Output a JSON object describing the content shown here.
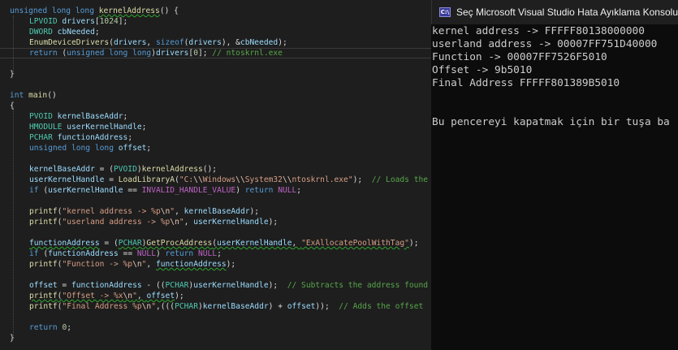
{
  "editor": {
    "code_lines": [
      [
        "unsigned long long ",
        "kernelAddress",
        "() {"
      ],
      [
        "LPVOID",
        " drivers",
        "[",
        "1024",
        "];"
      ],
      [
        "DWORD",
        " cbNeeded",
        ";"
      ],
      [
        "EnumDeviceDrivers",
        "(",
        "drivers",
        ", ",
        "sizeof",
        "(",
        "drivers",
        "), &",
        "cbNeeded",
        ");"
      ],
      [
        "return",
        " (",
        "unsigned long long",
        ")",
        "drivers",
        "[",
        "0",
        "]; ",
        "// ntoskrnl.exe"
      ],
      [
        "}"
      ],
      [
        "int",
        " main",
        "()"
      ],
      [
        "{"
      ],
      [
        "PVOID",
        " kernelBaseAddr",
        ";"
      ],
      [
        "HMODULE",
        " userKernelHandle",
        ";"
      ],
      [
        "PCHAR",
        " functionAddress",
        ";"
      ],
      [
        "unsigned long long",
        " offset",
        ";"
      ],
      [
        "kernelBaseAddr",
        " = (",
        "PVOID",
        ")",
        "kernelAddress",
        "();"
      ],
      [
        "userKernelHandle",
        " = ",
        "LoadLibraryA",
        "(",
        "\"C:",
        "\\\\",
        "Windows",
        "\\\\",
        "System32",
        "\\\\",
        "ntoskrnl.exe\"",
        ");  ",
        "// Loads the"
      ],
      [
        "if",
        " (",
        "userKernelHandle",
        " == ",
        "INVALID_HANDLE_VALUE",
        ") ",
        "return",
        " ",
        "NULL",
        ";"
      ],
      [
        "printf",
        "(",
        "\"kernel address -> %p",
        "\\n",
        "\"",
        ", ",
        "kernelBaseAddr",
        ");"
      ],
      [
        "printf",
        "(",
        "\"userland address -> %p",
        "\\n",
        "\"",
        ", ",
        "userKernelHandle",
        ");"
      ],
      [
        "functionAddress",
        " = (",
        "PCHAR",
        ")",
        "GetProcAddress",
        "(",
        "userKernelHandle",
        ", ",
        "\"ExAllocatePoolWithTag\"",
        ");"
      ],
      [
        "if",
        " (",
        "functionAddress",
        " == ",
        "NULL",
        ") ",
        "return",
        " ",
        "NULL",
        ";"
      ],
      [
        "printf",
        "(",
        "\"Function -> %p",
        "\\n",
        "\"",
        ", ",
        "functionAddress",
        ");"
      ],
      [
        "offset",
        " = ",
        "functionAddress",
        " - ((",
        "PCHAR",
        ")",
        "userKernelHandle",
        ");  ",
        "// Subtracts the address found"
      ],
      [
        "printf",
        "(",
        "\"Offset -> %x",
        "\\n",
        "\"",
        ", ",
        "offset",
        ");"
      ],
      [
        "printf",
        "(",
        "\"Final Address %p",
        "\\n",
        "\"",
        ",(((",
        "PCHAR",
        ")",
        "kernelBaseAddr",
        ") + ",
        "offset",
        "));  ",
        "// Adds the offset"
      ],
      [
        "return",
        " ",
        "0",
        ";"
      ],
      [
        "}"
      ]
    ]
  },
  "console": {
    "title": "Seç Microsoft Visual Studio Hata Ayıklama Konsolu",
    "icon_text": "C:\\",
    "lines": [
      "kernel address -> FFFFF80138000000",
      "userland address -> 00007FF751D40000",
      "Function -> 00007FF7526F5010",
      "Offset -> 9b5010",
      "Final Address FFFFF801389B5010",
      "",
      "Bu pencereyi kapatmak için bir tuşa ba"
    ]
  }
}
